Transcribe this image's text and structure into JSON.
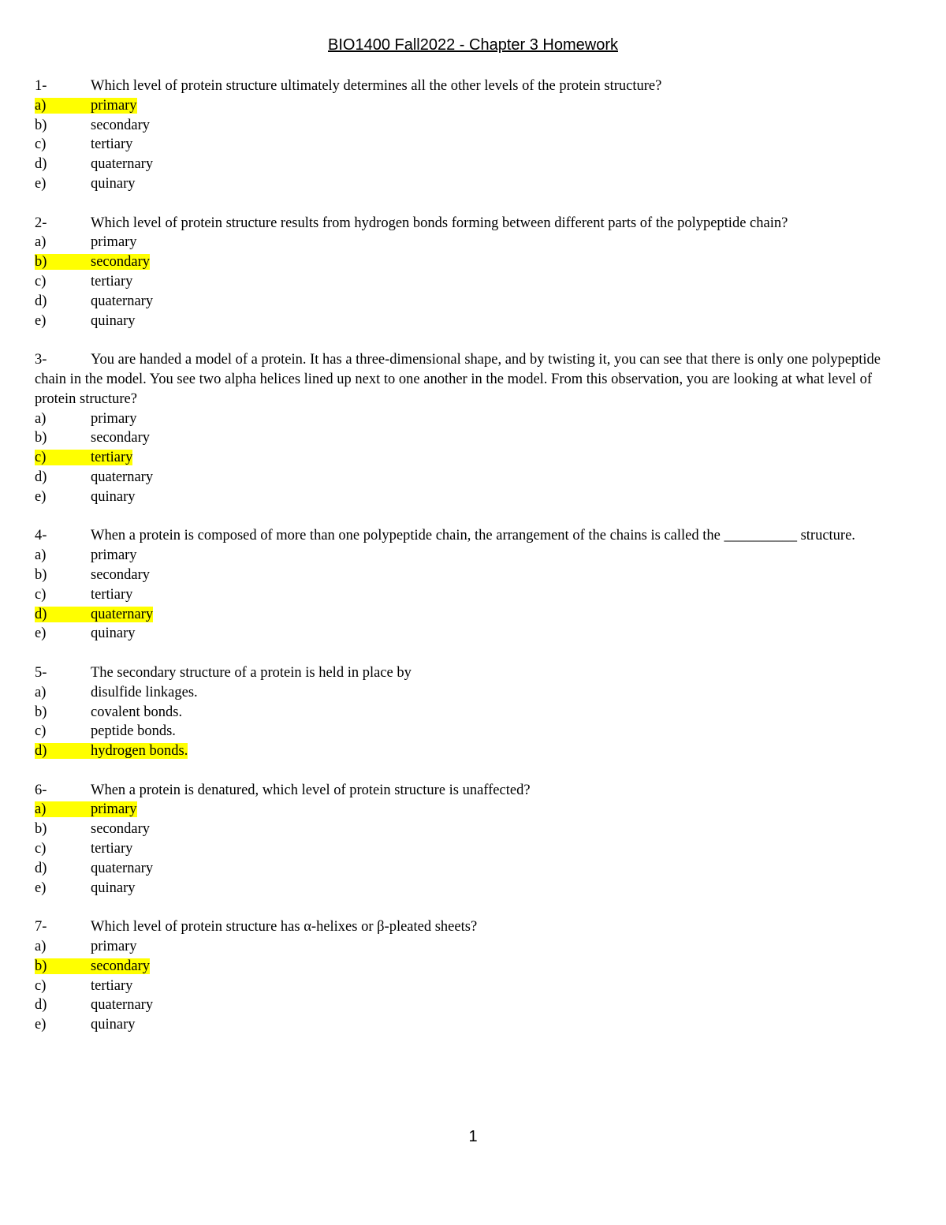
{
  "document": {
    "title": "BIO1400 Fall2022 - Chapter 3 Homework",
    "page_number": "1",
    "highlight_color": "#ffff00"
  },
  "questions": [
    {
      "number": "1-",
      "text": "Which level of protein structure ultimately determines all the other levels of the protein structure?",
      "options": [
        {
          "letter": "a)",
          "text": "primary",
          "correct": true
        },
        {
          "letter": "b)",
          "text": "secondary",
          "correct": false
        },
        {
          "letter": "c)",
          "text": "tertiary",
          "correct": false
        },
        {
          "letter": "d)",
          "text": "quaternary",
          "correct": false
        },
        {
          "letter": "e)",
          "text": "quinary",
          "correct": false
        }
      ]
    },
    {
      "number": "2-",
      "text": "Which level of protein structure results from hydrogen bonds forming between different parts of the polypeptide chain?",
      "options": [
        {
          "letter": "a)",
          "text": "primary",
          "correct": false
        },
        {
          "letter": "b)",
          "text": "secondary",
          "correct": true
        },
        {
          "letter": "c)",
          "text": "tertiary",
          "correct": false
        },
        {
          "letter": "d)",
          "text": "quaternary",
          "correct": false
        },
        {
          "letter": "e)",
          "text": "quinary",
          "correct": false
        }
      ]
    },
    {
      "number": "3-",
      "text": "You are handed a model of a protein. It has a three-dimensional shape, and by twisting it, you can see that there is only one polypeptide chain in the model. You see two alpha helices lined up next to one another in the model. From this observation, you are looking at what level of protein structure?",
      "options": [
        {
          "letter": "a)",
          "text": "primary",
          "correct": false
        },
        {
          "letter": "b)",
          "text": "secondary",
          "correct": false
        },
        {
          "letter": "c)",
          "text": "tertiary",
          "correct": true
        },
        {
          "letter": "d)",
          "text": "quaternary",
          "correct": false
        },
        {
          "letter": "e)",
          "text": "quinary",
          "correct": false
        }
      ]
    },
    {
      "number": "4-",
      "text": "When a protein is composed of more than one polypeptide chain, the arrangement of the chains is called the __________ structure.",
      "options": [
        {
          "letter": "a)",
          "text": "primary",
          "correct": false
        },
        {
          "letter": "b)",
          "text": "secondary",
          "correct": false
        },
        {
          "letter": "c)",
          "text": "tertiary",
          "correct": false
        },
        {
          "letter": "d)",
          "text": "quaternary",
          "correct": true
        },
        {
          "letter": "e)",
          "text": "quinary",
          "correct": false
        }
      ]
    },
    {
      "number": "5-",
      "text": "The secondary structure of a protein is held in place by",
      "options": [
        {
          "letter": "a)",
          "text": "disulfide linkages.",
          "correct": false
        },
        {
          "letter": "b)",
          "text": "covalent bonds.",
          "correct": false
        },
        {
          "letter": "c)",
          "text": "peptide bonds.",
          "correct": false
        },
        {
          "letter": "d)",
          "text": "hydrogen bonds.",
          "correct": true
        }
      ]
    },
    {
      "number": "6-",
      "text": "When a protein is denatured, which level of protein structure is unaffected?",
      "options": [
        {
          "letter": "a)",
          "text": "primary",
          "correct": true
        },
        {
          "letter": "b)",
          "text": "secondary",
          "correct": false
        },
        {
          "letter": "c)",
          "text": "tertiary",
          "correct": false
        },
        {
          "letter": "d)",
          "text": "quaternary",
          "correct": false
        },
        {
          "letter": "e)",
          "text": "quinary",
          "correct": false
        }
      ]
    },
    {
      "number": "7-",
      "text": "Which level of protein structure has α-helixes or β-pleated sheets?",
      "options": [
        {
          "letter": "a)",
          "text": "primary",
          "correct": false
        },
        {
          "letter": "b)",
          "text": "secondary",
          "correct": true
        },
        {
          "letter": "c)",
          "text": "tertiary",
          "correct": false
        },
        {
          "letter": "d)",
          "text": "quaternary",
          "correct": false
        },
        {
          "letter": "e)",
          "text": "quinary",
          "correct": false
        }
      ]
    }
  ]
}
